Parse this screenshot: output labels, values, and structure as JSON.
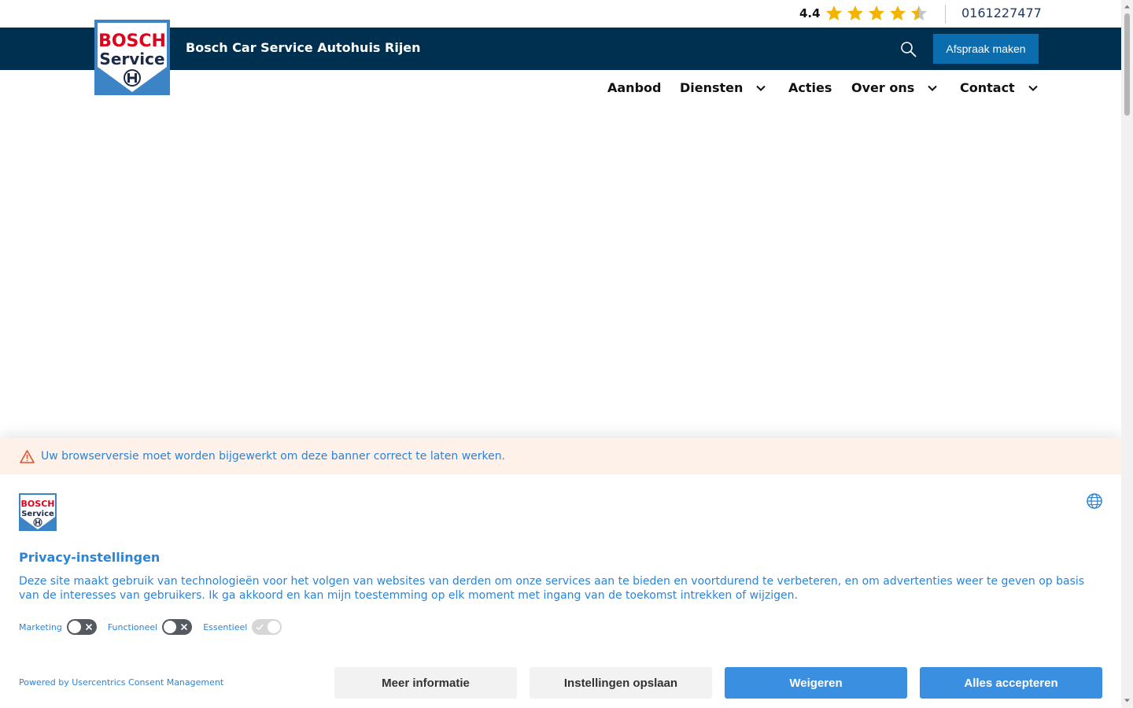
{
  "header": {
    "rating": "4.4",
    "rating_stars": 4.4,
    "rating_max": 5,
    "phone": "0161227477",
    "site_title": "Bosch Car Service Autohuis Rijen",
    "logo_line1": "BOSCH",
    "logo_line2": "Service",
    "search_icon": "search-icon",
    "cta_label": "Afspraak maken"
  },
  "nav": {
    "items": [
      {
        "label": "Aanbod",
        "has_dropdown": false
      },
      {
        "label": "Diensten",
        "has_dropdown": true
      },
      {
        "label": "Acties",
        "has_dropdown": false
      },
      {
        "label": "Over ons",
        "has_dropdown": true
      },
      {
        "label": "Contact",
        "has_dropdown": true
      }
    ]
  },
  "consent": {
    "warning": "Uw browserversie moet worden bijgewerkt om deze banner correct te laten werken.",
    "title": "Privacy-instellingen",
    "description": "Deze site maakt gebruik van technologieën voor het volgen van websites van derden om onze services aan te bieden en voortdurend te verbeteren, en om advertenties weer te geven op basis van de interesses van gebruikers. Ik ga akkoord en kan mijn toestemming op elk moment met ingang van de toekomst intrekken of wijzigen.",
    "toggles": [
      {
        "label": "Marketing",
        "enabled": false,
        "locked": false
      },
      {
        "label": "Functioneel",
        "enabled": false,
        "locked": false
      },
      {
        "label": "Essentieel",
        "enabled": true,
        "locked": true
      }
    ],
    "powered_by": "Powered by Usercentrics Consent Management",
    "buttons": {
      "more_info": "Meer informatie",
      "save_settings": "Instellingen opslaan",
      "deny": "Weigeren",
      "accept_all": "Alles accepteren"
    }
  },
  "colors": {
    "navy": "#00304f",
    "cta_blue": "#0b6cae",
    "consent_blue": "#2a84d8",
    "button_blue": "#3a8fe1",
    "star_gold": "#f5b301",
    "bosch_red": "#e2001a"
  }
}
